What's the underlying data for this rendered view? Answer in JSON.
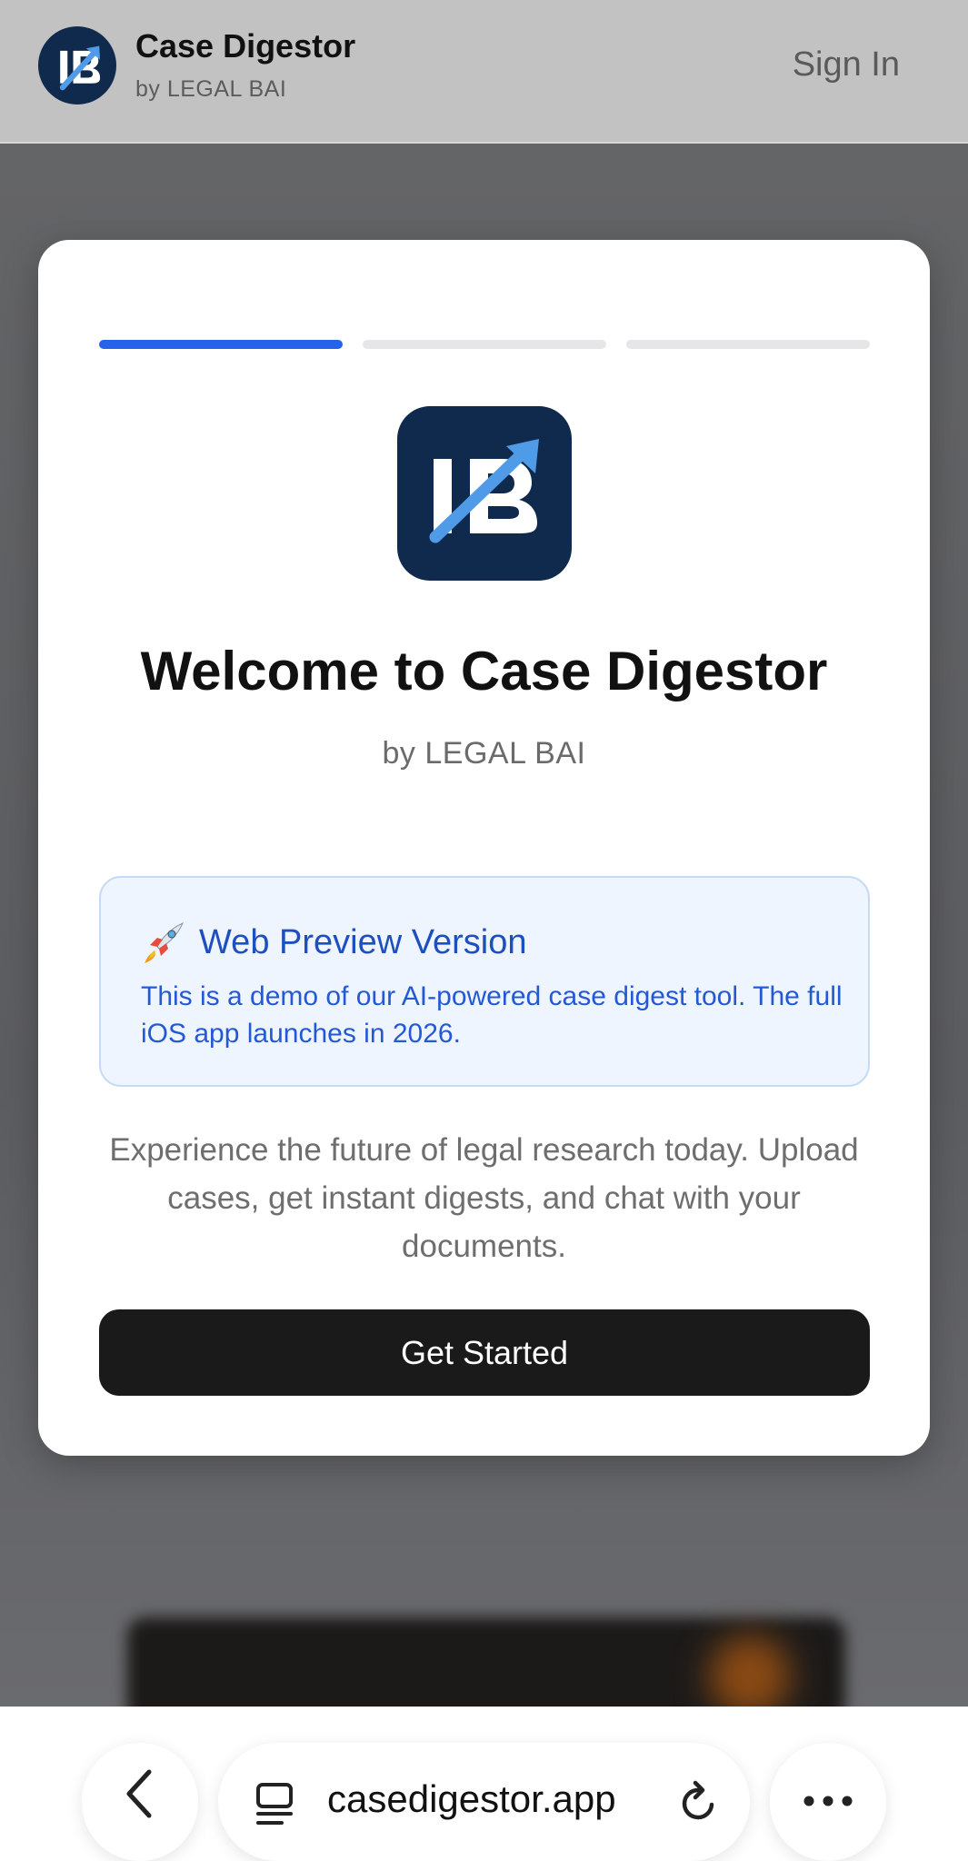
{
  "header": {
    "app_title": "Case Digestor",
    "app_subtitle": "by LEGAL BAI",
    "sign_in_label": "Sign In",
    "logo_icon": "lb-logo-icon"
  },
  "onboarding": {
    "progress": {
      "total_steps": 3,
      "current_step": 1
    },
    "app_icon": "lb-logo-icon",
    "title": "Welcome to Case Digestor",
    "subtitle": "by LEGAL BAI",
    "notice": {
      "icon": "rocket-icon",
      "title": "Web Preview Version",
      "body": "This is a demo of our AI-powered case digest tool. The full iOS app launches in 2026."
    },
    "description": "Experience the future of legal research today. Upload cases, get instant digests, and chat with your documents.",
    "cta_label": "Get Started"
  },
  "browser_bar": {
    "url": "casedigestor.app",
    "back_icon": "back-chevron-icon",
    "tabs_icon": "page-menu-icon",
    "reload_icon": "reload-icon",
    "more_icon": "more-icon"
  },
  "colors": {
    "accent": "#2563eb",
    "brand_navy": "#0f2a4c",
    "notice_bg": "#eff5ff",
    "notice_text": "#2459d6",
    "cta_bg": "#1a1a1a"
  }
}
